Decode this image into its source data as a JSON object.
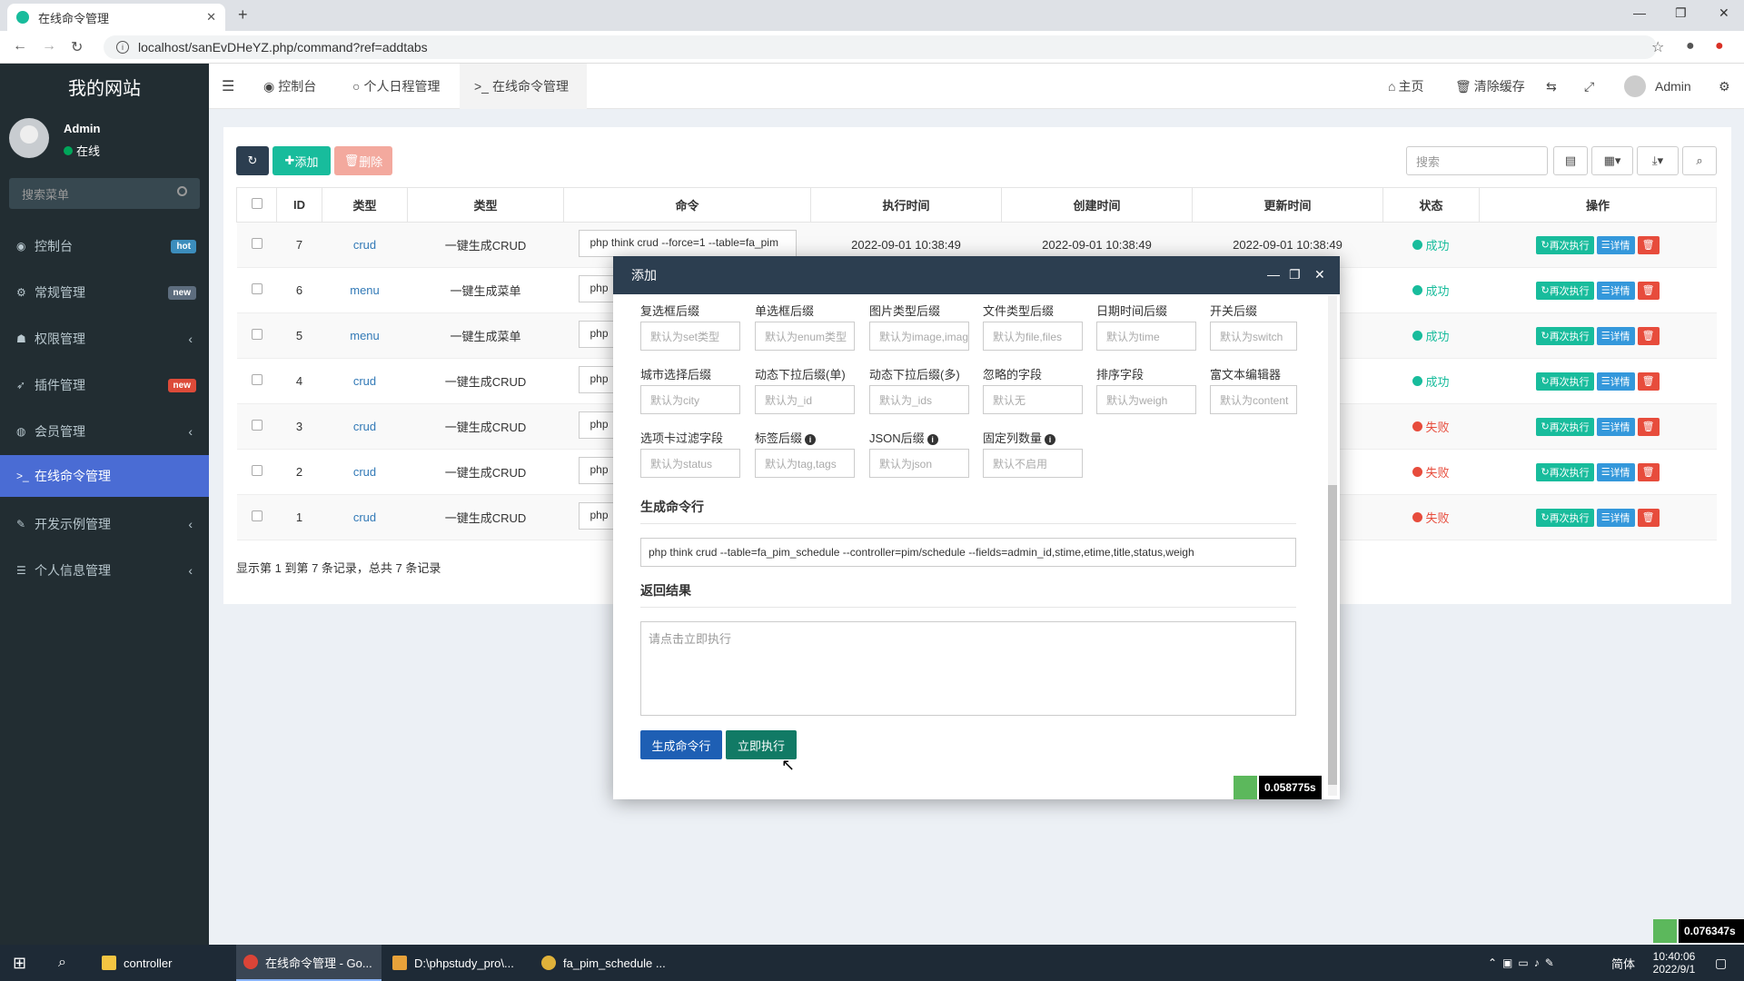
{
  "browser": {
    "tab_title": "在线命令管理",
    "new_tab": "+",
    "url": "localhost/sanEvDHeYZ.php/command?ref=addtabs"
  },
  "sidebar": {
    "site_name": "我的网站",
    "user_name": "Admin",
    "user_status": "在线",
    "search_placeholder": "搜索菜单",
    "items": [
      {
        "label": "控制台",
        "badge": "hot",
        "badge_color": "#3c8dbc"
      },
      {
        "label": "常规管理",
        "badge": "new",
        "badge_color": "#5d6d7e"
      },
      {
        "label": "权限管理",
        "chevron": "‹"
      },
      {
        "label": "插件管理",
        "badge": "new",
        "badge_color": "#dd4b39"
      },
      {
        "label": "会员管理",
        "chevron": "‹"
      },
      {
        "label": "在线命令管理",
        "active": true
      },
      {
        "label": "开发示例管理",
        "chevron": "‹"
      },
      {
        "label": "个人信息管理",
        "chevron": "‹"
      }
    ]
  },
  "header": {
    "tabs": [
      "控制台",
      "个人日程管理",
      "在线命令管理"
    ],
    "home": "主页",
    "clear_cache": "清除缓存",
    "admin": "Admin"
  },
  "toolbar": {
    "add": "添加",
    "delete": "删除",
    "search_placeholder": "搜索"
  },
  "table": {
    "columns": [
      "ID",
      "类型",
      "类型",
      "命令",
      "执行时间",
      "创建时间",
      "更新时间",
      "状态",
      "操作"
    ],
    "rows": [
      {
        "id": "7",
        "type": "crud",
        "type_text": "一键生成CRUD",
        "command": "php think crud --force=1 --table=fa_pim",
        "exec_time": "2022-09-01 10:38:49",
        "create_time": "2022-09-01 10:38:49",
        "update_time": "2022-09-01 10:38:49",
        "status": "成功"
      },
      {
        "id": "6",
        "type": "menu",
        "type_text": "一键生成菜单",
        "command": "php",
        "status": "成功"
      },
      {
        "id": "5",
        "type": "menu",
        "type_text": "一键生成菜单",
        "command": "php",
        "status": "成功"
      },
      {
        "id": "4",
        "type": "crud",
        "type_text": "一键生成CRUD",
        "command": "php",
        "status": "成功"
      },
      {
        "id": "3",
        "type": "crud",
        "type_text": "一键生成CRUD",
        "command": "php",
        "status": "失败"
      },
      {
        "id": "2",
        "type": "crud",
        "type_text": "一键生成CRUD",
        "command": "php",
        "status": "失败"
      },
      {
        "id": "1",
        "type": "crud",
        "type_text": "一键生成CRUD",
        "command": "php",
        "status": "失败"
      }
    ],
    "op_rerun": "再次执行",
    "op_detail": "详情",
    "status_colors": {
      "成功": "#18bc9c",
      "失败": "#e74c3c"
    },
    "page_info": "显示第 1 到第 7 条记录，总共 7 条记录"
  },
  "modal": {
    "title": "添加",
    "fields": [
      {
        "label": "复选框后缀",
        "placeholder": "默认为set类型"
      },
      {
        "label": "单选框后缀",
        "placeholder": "默认为enum类型"
      },
      {
        "label": "图片类型后缀",
        "placeholder": "默认为image,images"
      },
      {
        "label": "文件类型后缀",
        "placeholder": "默认为file,files"
      },
      {
        "label": "日期时间后缀",
        "placeholder": "默认为time"
      },
      {
        "label": "开关后缀",
        "placeholder": "默认为switch"
      },
      {
        "label": "城市选择后缀",
        "placeholder": "默认为city"
      },
      {
        "label": "动态下拉后缀(单)",
        "placeholder": "默认为_id"
      },
      {
        "label": "动态下拉后缀(多)",
        "placeholder": "默认为_ids"
      },
      {
        "label": "忽略的字段",
        "placeholder": "默认无"
      },
      {
        "label": "排序字段",
        "placeholder": "默认为weigh"
      },
      {
        "label": "富文本编辑器",
        "placeholder": "默认为content"
      },
      {
        "label": "选项卡过滤字段",
        "placeholder": "默认为status"
      },
      {
        "label": "标签后缀",
        "placeholder": "默认为tag,tags",
        "info": true
      },
      {
        "label": "JSON后缀",
        "placeholder": "默认为json",
        "info": true
      },
      {
        "label": "固定列数量",
        "placeholder": "默认不启用",
        "info": true
      }
    ],
    "gen_section": "生成命令行",
    "command_value": "php think crud --table=fa_pim_schedule --controller=pim/schedule --fields=admin_id,stime,etime,title,status,weigh",
    "result_section": "返回结果",
    "result_placeholder": "请点击立即执行",
    "btn_generate": "生成命令行",
    "btn_execute": "立即执行",
    "timer": "0.058775s"
  },
  "page_timer": "0.076347s",
  "taskbar": {
    "items": [
      "controller",
      "在线命令管理 - Go...",
      "D:\\phpstudy_pro\\...",
      "fa_pim_schedule ..."
    ],
    "ime": "简体",
    "time": "10:40:06",
    "date": "2022/9/1"
  }
}
